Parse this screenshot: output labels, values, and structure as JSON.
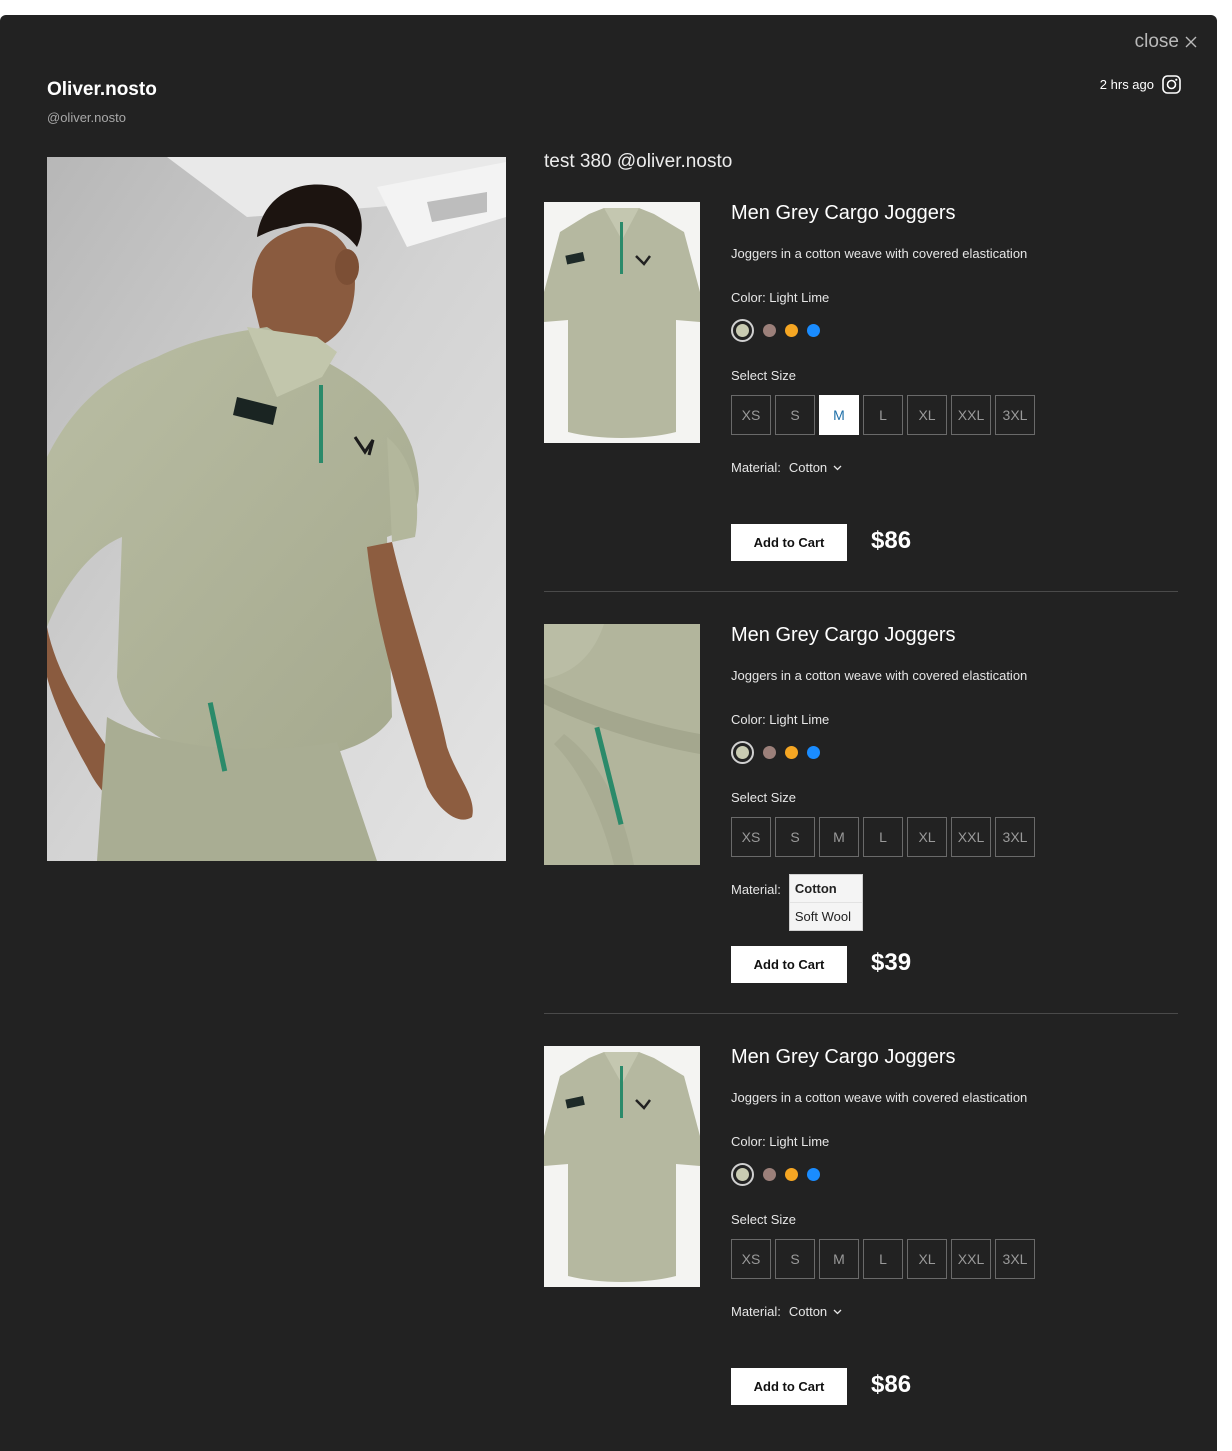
{
  "modal": {
    "close_label": "close",
    "author_name": "Oliver.nosto",
    "author_handle": "@oliver.nosto",
    "posted_ago": "2 hrs ago",
    "caption": "test 380 @oliver.nosto"
  },
  "colors": {
    "background": "#222222",
    "swatches": [
      "#c9cbb2",
      "#9c807a",
      "#f5a623",
      "#1a8cff"
    ]
  },
  "products": [
    {
      "title": "Men Grey Cargo Joggers",
      "description": "Joggers in a cotton weave with covered elastication",
      "color_label": "Color: Light Lime",
      "size_label": "Select Size",
      "sizes": [
        "XS",
        "S",
        "M",
        "L",
        "XL",
        "XXL",
        "3XL"
      ],
      "selected_size": "M",
      "material_label": "Material:",
      "material_value": "Cotton",
      "add_to_cart": "Add to Cart",
      "price": "$86",
      "image": "polo-shirt-front"
    },
    {
      "title": "Men Grey Cargo Joggers",
      "description": "Joggers in a cotton weave with covered elastication",
      "color_label": "Color: Light Lime",
      "size_label": "Select Size",
      "sizes": [
        "XS",
        "S",
        "M",
        "L",
        "XL",
        "XXL",
        "3XL"
      ],
      "selected_size": "",
      "material_label": "Material:",
      "material_options": [
        "Cotton",
        "Soft Wool"
      ],
      "add_to_cart": "Add to Cart",
      "price": "$39",
      "image": "shirt-detail-closeup"
    },
    {
      "title": "Men Grey Cargo Joggers",
      "description": "Joggers in a cotton weave with covered elastication",
      "color_label": "Color: Light Lime",
      "size_label": "Select Size",
      "sizes": [
        "XS",
        "S",
        "M",
        "L",
        "XL",
        "XXL",
        "3XL"
      ],
      "selected_size": "",
      "material_label": "Material:",
      "material_value": "Cotton",
      "add_to_cart": "Add to Cart",
      "price": "$86",
      "image": "polo-shirt-front"
    }
  ]
}
